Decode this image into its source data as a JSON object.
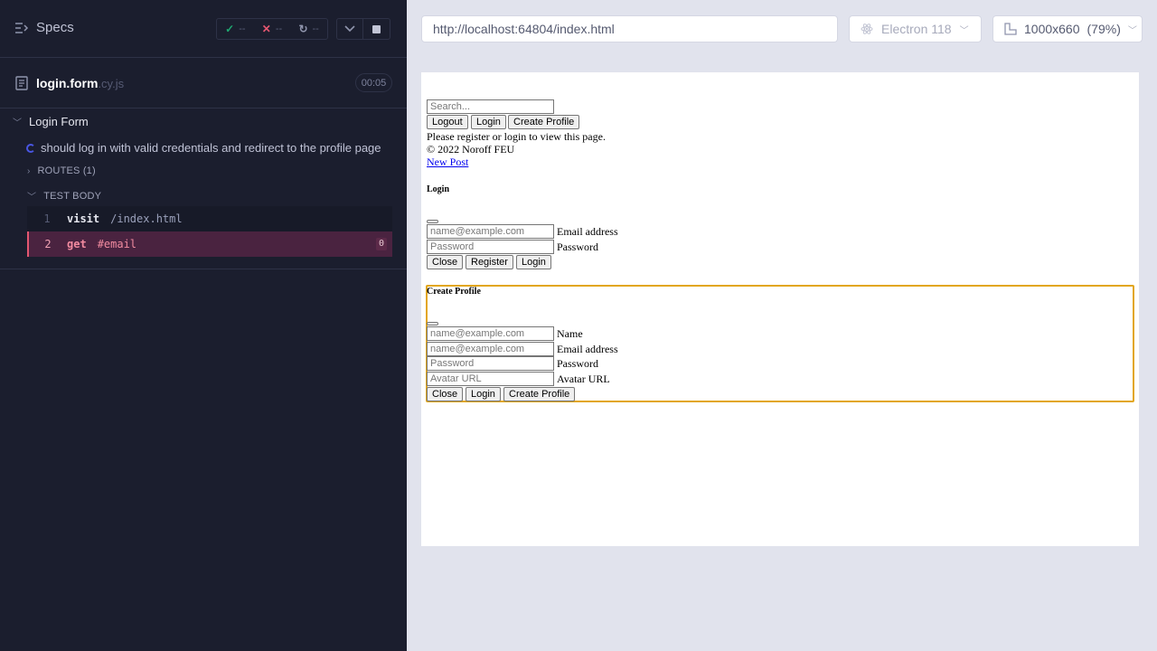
{
  "runner": {
    "specs_label": "Specs",
    "stats": {
      "passed": "--",
      "failed": "--",
      "pending": "--"
    },
    "file": {
      "name": "login.form",
      "ext": ".cy.js",
      "time": "00:05"
    },
    "suite_title": "Login Form",
    "test_title": "should log in with valid credentials and redirect to the profile page",
    "routes_label": "ROUTES (1)",
    "test_body_label": "TEST BODY",
    "commands": [
      {
        "num": "1",
        "name": "visit",
        "arg": "/index.html"
      },
      {
        "num": "2",
        "name": "get",
        "arg": "#email",
        "badge": "0"
      }
    ]
  },
  "browser_bar": {
    "url": "http://localhost:64804/index.html",
    "browser": "Electron 118",
    "viewport": "1000x660",
    "scale": "(79%)"
  },
  "app": {
    "search_placeholder": "Search...",
    "nav_buttons": [
      "Logout",
      "Login",
      "Create Profile"
    ],
    "message": "Please register or login to view this page.",
    "copyright": "© 2022 Noroff FEU",
    "new_post_link": "New Post",
    "login_modal": {
      "title": "Login",
      "email_placeholder": "name@example.com",
      "email_label": "Email address",
      "password_placeholder": "Password",
      "password_label": "Password",
      "buttons": [
        "Close",
        "Register",
        "Login"
      ]
    },
    "profile_modal": {
      "title": "Create Profile",
      "name_placeholder": "name@example.com",
      "name_label": "Name",
      "email_placeholder": "name@example.com",
      "email_label": "Email address",
      "password_placeholder": "Password",
      "password_label": "Password",
      "avatar_placeholder": "Avatar URL",
      "avatar_label": "Avatar URL",
      "buttons": [
        "Close",
        "Login",
        "Create Profile"
      ]
    }
  },
  "colors": {
    "runner_bg": "#1b1e2e",
    "active_command_bg": "#4a2340",
    "highlight_border": "#e2a61a",
    "pass": "#1fa971",
    "fail": "#e45770"
  }
}
